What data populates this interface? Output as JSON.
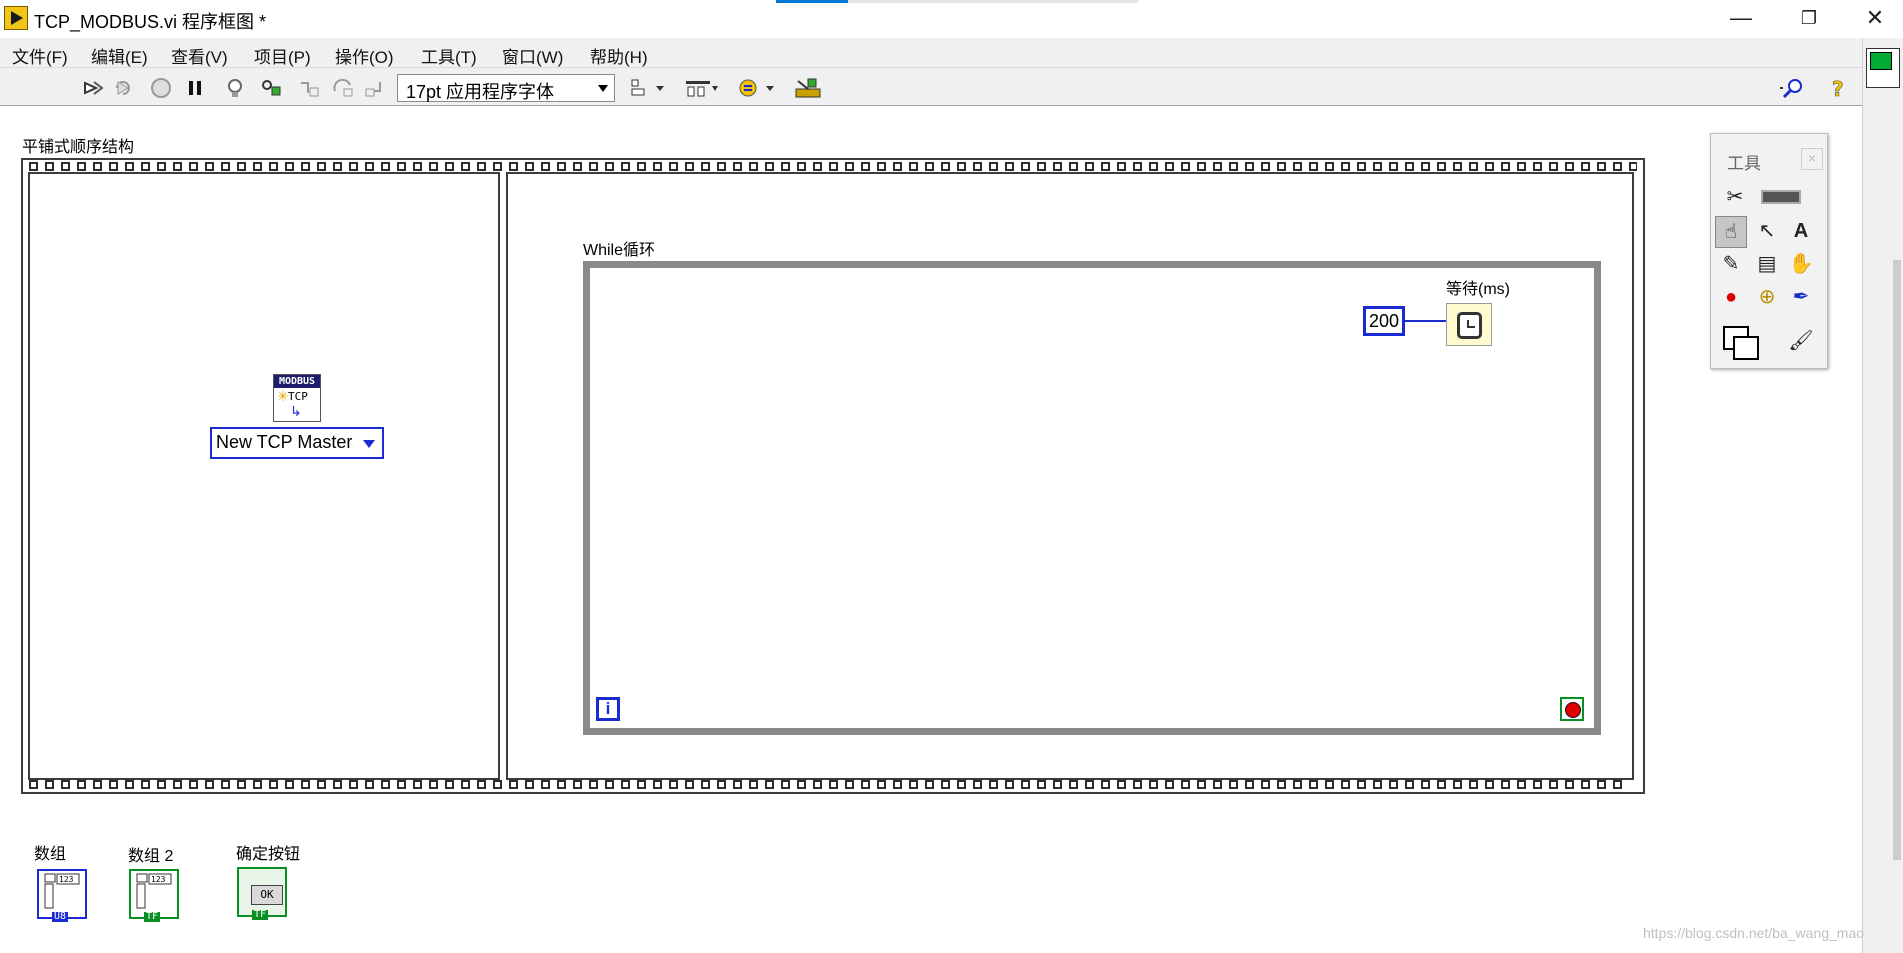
{
  "window": {
    "title": "TCP_MODBUS.vi 程序框图 *",
    "controls": {
      "minimize": "—",
      "restore": "❐",
      "close": "✕"
    }
  },
  "menubar": {
    "items": [
      "文件(F)",
      "编辑(E)",
      "查看(V)",
      "项目(P)",
      "操作(O)",
      "工具(T)",
      "窗口(W)",
      "帮助(H)"
    ]
  },
  "toolbar": {
    "font_select": "17pt 应用程序字体",
    "icons": [
      "run-arrow-icon",
      "run-continuously-icon",
      "abort-icon",
      "pause-icon",
      "highlight-execution-icon",
      "retain-wire-values-icon",
      "step-into-icon",
      "step-over-icon",
      "step-out-icon",
      "align-objects-icon",
      "distribute-objects-icon",
      "reorder-icon",
      "clean-up-diagram-icon",
      "search-icon",
      "help-icon"
    ]
  },
  "diagram": {
    "flat_sequence_label": "平铺式顺序结构",
    "while_label": "While循环",
    "wait_label": "等待(ms)",
    "wait_constant": "200",
    "iteration_terminal": "i",
    "modbus_icon_header": "MODBUS",
    "modbus_icon_tcp": "TCP",
    "ring_value": "New TCP Master",
    "terminals": [
      {
        "label": "数组",
        "tag": "U8"
      },
      {
        "label": "数组 2",
        "tag": "TF"
      },
      {
        "label": "确定按钮",
        "tag": "TF",
        "button_text": "OK"
      }
    ]
  },
  "tools_palette": {
    "title": "工具",
    "close": "×",
    "tools": [
      "auto-tool-icon",
      "color-preview-icon",
      "operate-hand-icon",
      "position-arrow-icon",
      "text-tool-icon",
      "connect-wire-icon",
      "shortcut-menu-icon",
      "scroll-hand-icon",
      "breakpoint-icon",
      "probe-icon",
      "color-picker-icon",
      "color-swatch-icon",
      "brush-icon"
    ]
  },
  "colors": {
    "accent_blue": "#1a2bd1",
    "boolean_green": "#0a8f24",
    "while_frame": "#8a8a8a",
    "wait_node_bg": "#fffbcf"
  },
  "watermark": "https://blog.csdn.net/ba_wang_mao"
}
